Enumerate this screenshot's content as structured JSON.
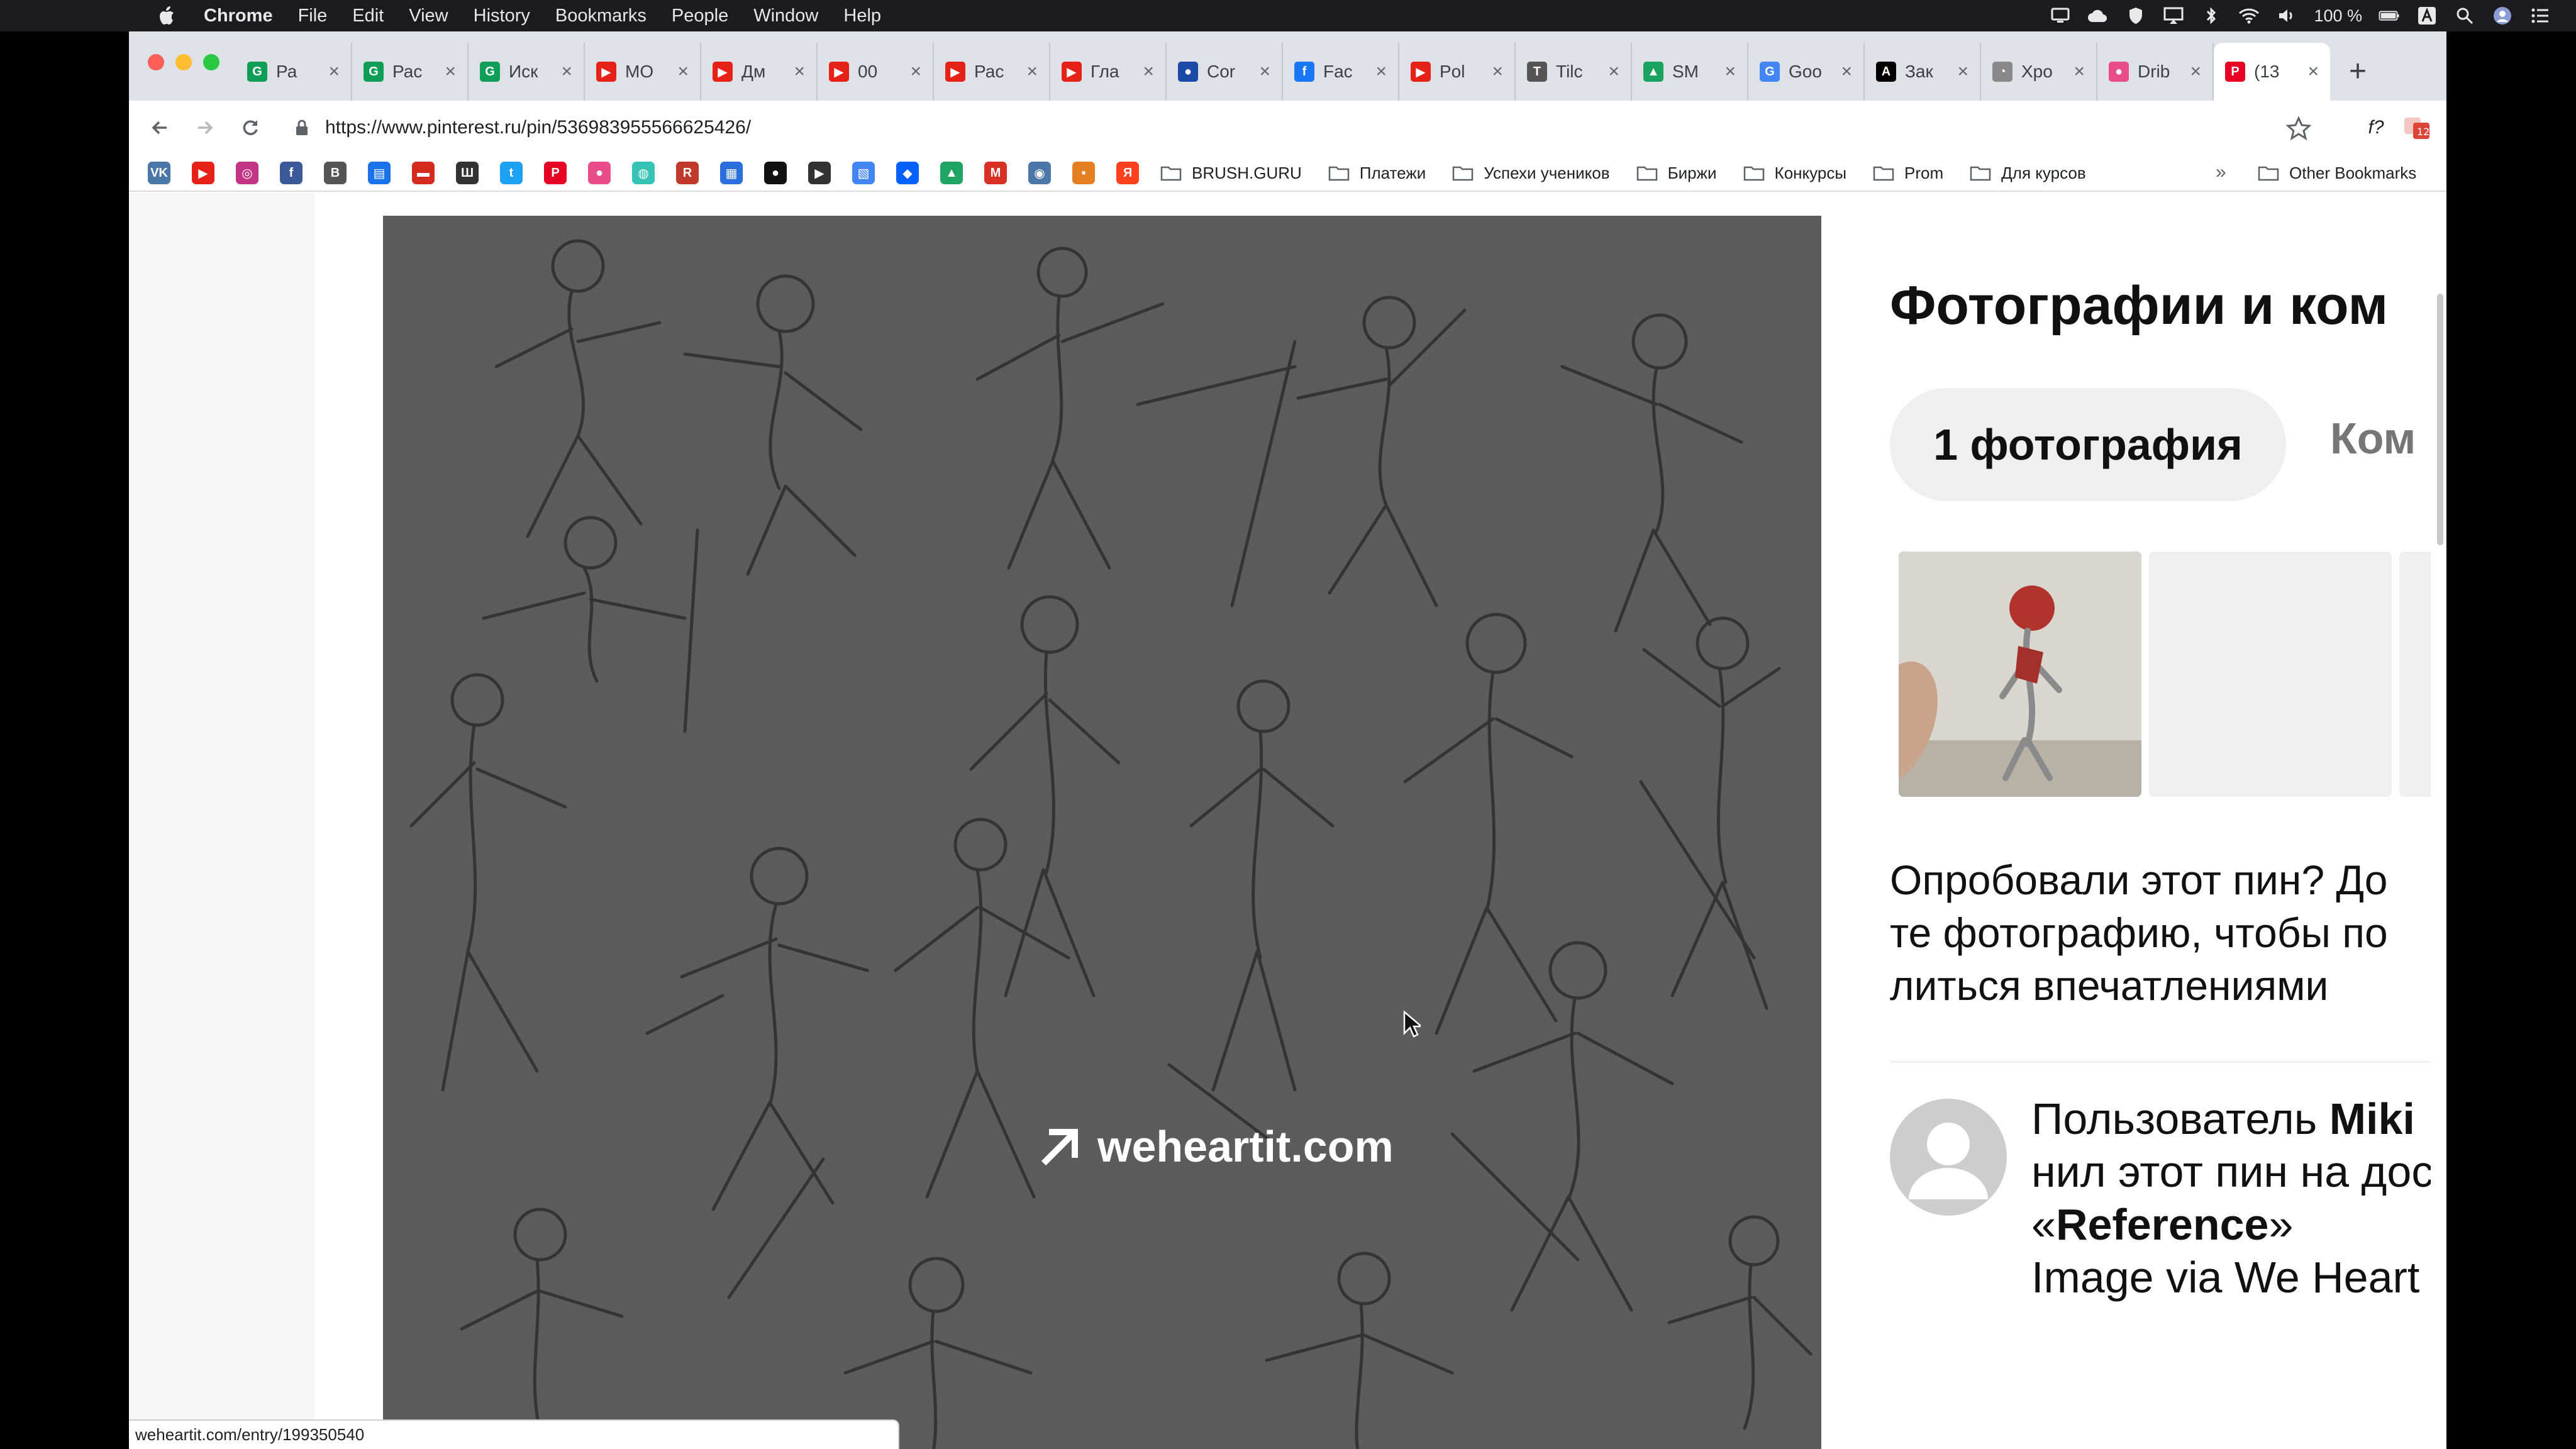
{
  "menubar": {
    "app": "Chrome",
    "items": [
      "File",
      "Edit",
      "View",
      "History",
      "Bookmarks",
      "People",
      "Window",
      "Help"
    ],
    "battery": "100 %"
  },
  "tabs": [
    {
      "title": "Ра",
      "favicon": "G",
      "color": "#0f9d58"
    },
    {
      "title": "Рас",
      "favicon": "G",
      "color": "#0f9d58"
    },
    {
      "title": "Иск",
      "favicon": "G",
      "color": "#0f9d58"
    },
    {
      "title": "МО",
      "favicon": "▶",
      "color": "#e62117"
    },
    {
      "title": "Дм",
      "favicon": "▶",
      "color": "#e62117"
    },
    {
      "title": "00",
      "favicon": "▶",
      "color": "#e62117"
    },
    {
      "title": "Рас",
      "favicon": "▶",
      "color": "#e62117"
    },
    {
      "title": "Гла",
      "favicon": "▶",
      "color": "#e62117"
    },
    {
      "title": "Cor",
      "favicon": "●",
      "color": "#1c4aa8"
    },
    {
      "title": "Fac",
      "favicon": "f",
      "color": "#1877f2"
    },
    {
      "title": "Pol",
      "favicon": "▶",
      "color": "#e62117"
    },
    {
      "title": "Tilc",
      "favicon": "T",
      "color": "#555555"
    },
    {
      "title": "SM",
      "favicon": "▲",
      "color": "#1aa260"
    },
    {
      "title": "Goo",
      "favicon": "G",
      "color": "#4285f4"
    },
    {
      "title": "Зак",
      "favicon": "A",
      "color": "#000000"
    },
    {
      "title": "Хро",
      "favicon": "◔",
      "color": "#888888"
    },
    {
      "title": "Drib",
      "favicon": "●",
      "color": "#ea4c89"
    },
    {
      "title": "(13",
      "favicon": "P",
      "color": "#e60023",
      "active": true
    }
  ],
  "toolbar": {
    "url": "https://www.pinterest.ru/pin/536983955566625426/"
  },
  "bookmarks": {
    "icons": [
      {
        "glyph": "VK",
        "color": "#4a76a8"
      },
      {
        "glyph": "▶",
        "color": "#e62117"
      },
      {
        "glyph": "◎",
        "color": "#c13584"
      },
      {
        "glyph": "f",
        "color": "#3b5998"
      },
      {
        "glyph": "B",
        "color": "#555555"
      },
      {
        "glyph": "▤",
        "color": "#1a73e8"
      },
      {
        "glyph": "▬",
        "color": "#d52b1e"
      },
      {
        "glyph": "Ш",
        "color": "#333333"
      },
      {
        "glyph": "t",
        "color": "#1da1f2"
      },
      {
        "glyph": "P",
        "color": "#e60023"
      },
      {
        "glyph": "●",
        "color": "#ea4c89"
      },
      {
        "glyph": "◍",
        "color": "#35c3b5"
      },
      {
        "glyph": "R",
        "color": "#c0392b"
      },
      {
        "glyph": "▦",
        "color": "#2a6fdb"
      },
      {
        "glyph": "●",
        "color": "#111111"
      },
      {
        "glyph": "▶",
        "color": "#333333"
      },
      {
        "glyph": "▧",
        "color": "#4285f4"
      },
      {
        "glyph": "◆",
        "color": "#0061ff"
      },
      {
        "glyph": "▲",
        "color": "#1fa463"
      },
      {
        "glyph": "M",
        "color": "#d93025"
      },
      {
        "glyph": "◉",
        "color": "#4a76a8"
      },
      {
        "glyph": "▪",
        "color": "#e67e22"
      },
      {
        "glyph": "Я",
        "color": "#fc3f1d"
      }
    ],
    "folders": [
      "BRUSH.GURU",
      "Платежи",
      "Успехи учеников",
      "Биржи",
      "Конкурсы",
      "Prom",
      "Для курсов"
    ],
    "more": "»",
    "other": "Other Bookmarks"
  },
  "pin": {
    "source_domain": "weheartit.com"
  },
  "side": {
    "title": "Фотографии и ком",
    "tab_photos": "1 фотография",
    "tab_comments": "Ком",
    "try_lines": [
      "Опробовали этот пин? До",
      "те фотографию, чтобы по",
      "литься впечатлениями"
    ],
    "saved": {
      "prefix": "Пользователь ",
      "user": "Miki",
      "line2": "нил этот пин на дос",
      "quote_open": "«",
      "board": "Reference",
      "quote_close": "»",
      "line4": "Image via We Heart"
    }
  },
  "statusbar": {
    "text": "weheartit.com/entry/199350540"
  }
}
